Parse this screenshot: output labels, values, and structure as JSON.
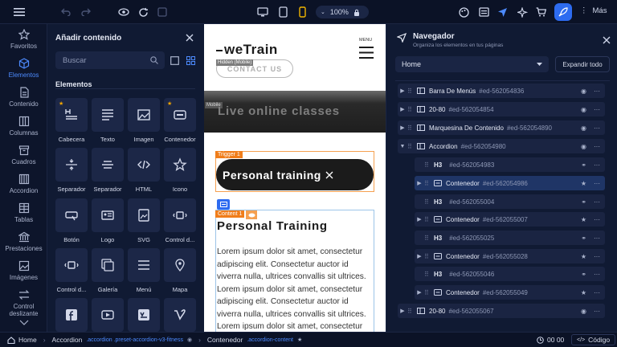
{
  "toolbar": {
    "zoom": "100%",
    "more_label": "Más"
  },
  "rail": {
    "items": [
      {
        "label": "Favoritos",
        "icon": "star-icon"
      },
      {
        "label": "Elementos",
        "icon": "cube-icon"
      },
      {
        "label": "Contenido",
        "icon": "document-icon"
      },
      {
        "label": "Columnas",
        "icon": "columns-icon"
      },
      {
        "label": "Cuadros",
        "icon": "box-icon"
      },
      {
        "label": "Accordion",
        "icon": "accordion-icon"
      },
      {
        "label": "Tablas",
        "icon": "table-icon"
      },
      {
        "label": "Prestaciones",
        "icon": "bank-icon"
      },
      {
        "label": "Imágenes",
        "icon": "image-icon"
      },
      {
        "label": "Control deslizante",
        "icon": "slider-icon"
      }
    ]
  },
  "panel": {
    "title": "Añadir contenido",
    "search_placeholder": "Buscar",
    "section": "Elementos",
    "tiles": [
      "Cabecera",
      "Texto",
      "Imagen",
      "Contenedor",
      "Separador",
      "Separador",
      "HTML",
      "Icono",
      "Botón",
      "Logo",
      "SVG",
      "Control d...",
      "Control d...",
      "Galería",
      "Menú",
      "Mapa",
      "",
      "",
      "",
      ""
    ]
  },
  "canvas": {
    "brand": "weTrain",
    "menu": "MENU",
    "contact": "CONTACT US",
    "hidden_mobile": "Hidden (Mobile)",
    "mobile_tag": "Mobile",
    "hero_text": "Live online classes",
    "trigger_tag": "Trigger 1",
    "accordion_title": "Personal training",
    "content_tag": "Content 1",
    "heading": "Personal Training",
    "body": "Lorem ipsum dolor sit amet, consectetur adipiscing elit. Consectetur auctor id viverra nulla, ultrices convallis sit ultrices. Lorem ipsum dolor sit amet, consectetur adipiscing elit. Consectetur auctor id viverra nulla, ultrices convallis sit ultrices. Lorem ipsum dolor sit amet, consectetur"
  },
  "navigator": {
    "title": "Navegador",
    "subtitle": "Organiza los elementos en tus páginas",
    "page": "Home",
    "expand_all": "Expandir todo",
    "rows": [
      {
        "name": "Barra De Menús",
        "id": "#ed-562054836",
        "level": 0,
        "arrow": "▶"
      },
      {
        "name": "20-80",
        "id": "#ed-562054854",
        "level": 0,
        "arrow": "▶"
      },
      {
        "name": "Marquesina De Contenido",
        "id": "#ed-562054890",
        "level": 0,
        "arrow": "▶"
      },
      {
        "name": "Accordion",
        "id": "#ed-562054980",
        "level": 0,
        "arrow": "▼"
      },
      {
        "name": "H3",
        "id": "#ed-562054983",
        "level": 1,
        "arrow": ""
      },
      {
        "name": "Contenedor",
        "id": "#ed-562054986",
        "level": 1,
        "arrow": "▶",
        "selected": true
      },
      {
        "name": "H3",
        "id": "#ed-562055004",
        "level": 1,
        "arrow": ""
      },
      {
        "name": "Contenedor",
        "id": "#ed-562055007",
        "level": 1,
        "arrow": "▶"
      },
      {
        "name": "H3",
        "id": "#ed-562055025",
        "level": 1,
        "arrow": ""
      },
      {
        "name": "Contenedor",
        "id": "#ed-562055028",
        "level": 1,
        "arrow": "▶"
      },
      {
        "name": "H3",
        "id": "#ed-562055046",
        "level": 1,
        "arrow": ""
      },
      {
        "name": "Contenedor",
        "id": "#ed-562055049",
        "level": 1,
        "arrow": "▶"
      },
      {
        "name": "20-80",
        "id": "#ed-562055067",
        "level": 0,
        "arrow": "▶"
      }
    ]
  },
  "bottom": {
    "home": "Home",
    "crumb1": "Accordion",
    "crumb1_class": ".accordion .preset-accordion-v3-fitness",
    "crumb2": "Contenedor",
    "crumb2_class": ".accordion-content",
    "time": "00 00",
    "code": "Código"
  },
  "colors": {
    "accent": "#2d6bf0",
    "tag_orange": "#f07d1a",
    "canvas_dark": "#1e1e1e"
  }
}
